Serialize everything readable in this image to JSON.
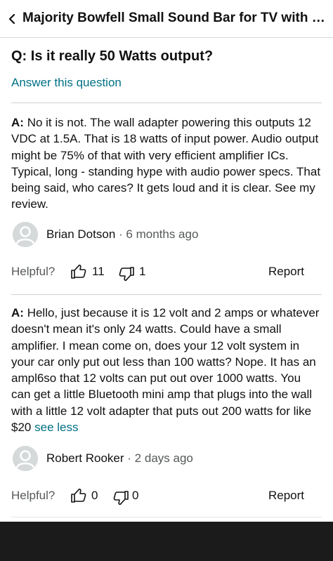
{
  "header": {
    "title": "Majority Bowfell Small Sound Bar for TV with Bluetooth"
  },
  "question": {
    "prefix": "Q:",
    "text": "Is it really 50 Watts output?",
    "answer_link": "Answer this question"
  },
  "answers": [
    {
      "prefix": "A:",
      "text": "No it is not. The wall adapter powering this outputs 12 VDC at 1.5A. That is 18 watts of input power. Audio output might be 75% of that with very efficient amplifier ICs. Typical, long - standing hype with audio power specs. That being said, who cares? It gets loud and it is clear. See my review.",
      "author": "Brian Dotson",
      "date": "· 6 months ago",
      "helpful_label": "Helpful?",
      "up_count": "11",
      "down_count": "1",
      "report_label": "Report"
    },
    {
      "prefix": "A:",
      "text": "Hello, just because it is 12 volt and 2 amps or whatever doesn't mean it's only 24 watts. Could have a small amplifier. I mean come on, does your 12 volt system in your car only put out less than 100 watts? Nope. It has an ampl6so that 12 volts can put out over 1000 watts. You can get a little Bluetooth mini amp that plugs into the wall with a little 12 volt adapter that puts out 200 watts for like $20",
      "see_less": "see less",
      "author": "Robert Rooker",
      "date": "· 2 days ago",
      "helpful_label": "Helpful?",
      "up_count": "0",
      "down_count": "0",
      "report_label": "Report"
    }
  ],
  "colors": {
    "link": "#007185",
    "muted": "#565959",
    "divider": "#cfd3d3",
    "bottom_bar": "#1b1b1b"
  },
  "icons": {
    "back": "chevron-left-icon",
    "avatar": "user-silhouette-icon",
    "up": "thumbs-up-outline-icon",
    "down": "thumbs-down-outline-icon"
  }
}
